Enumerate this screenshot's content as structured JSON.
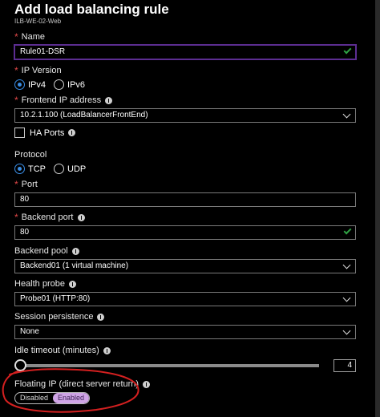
{
  "header": {
    "title": "Add load balancing rule",
    "subtitle": "ILB-WE-02-Web"
  },
  "name": {
    "label": "Name",
    "value": "Rule01-DSR"
  },
  "ip_version": {
    "label": "IP Version",
    "options": [
      "IPv4",
      "IPv6"
    ],
    "selected": "IPv4"
  },
  "frontend": {
    "label": "Frontend IP address",
    "value": "10.2.1.100 (LoadBalancerFrontEnd)"
  },
  "ha_ports": {
    "label": "HA Ports"
  },
  "protocol": {
    "label": "Protocol",
    "options": [
      "TCP",
      "UDP"
    ],
    "selected": "TCP"
  },
  "port": {
    "label": "Port",
    "value": "80"
  },
  "backend_port": {
    "label": "Backend port",
    "value": "80"
  },
  "backend_pool": {
    "label": "Backend pool",
    "value": "Backend01 (1 virtual machine)"
  },
  "health_probe": {
    "label": "Health probe",
    "value": "Probe01 (HTTP:80)"
  },
  "session": {
    "label": "Session persistence",
    "value": "None"
  },
  "idle": {
    "label": "Idle timeout (minutes)",
    "value": "4",
    "level": 0.0
  },
  "floating": {
    "label": "Floating IP (direct server return)",
    "off": "Disabled",
    "on": "Enabled",
    "selected": "Enabled"
  },
  "colors": {
    "accent": "#5c2d91",
    "radio": "#3a8ee6",
    "valid": "#2ea043",
    "required": "#e04848",
    "annotation": "#d42020",
    "toggle_on": "#cfa4e6"
  }
}
